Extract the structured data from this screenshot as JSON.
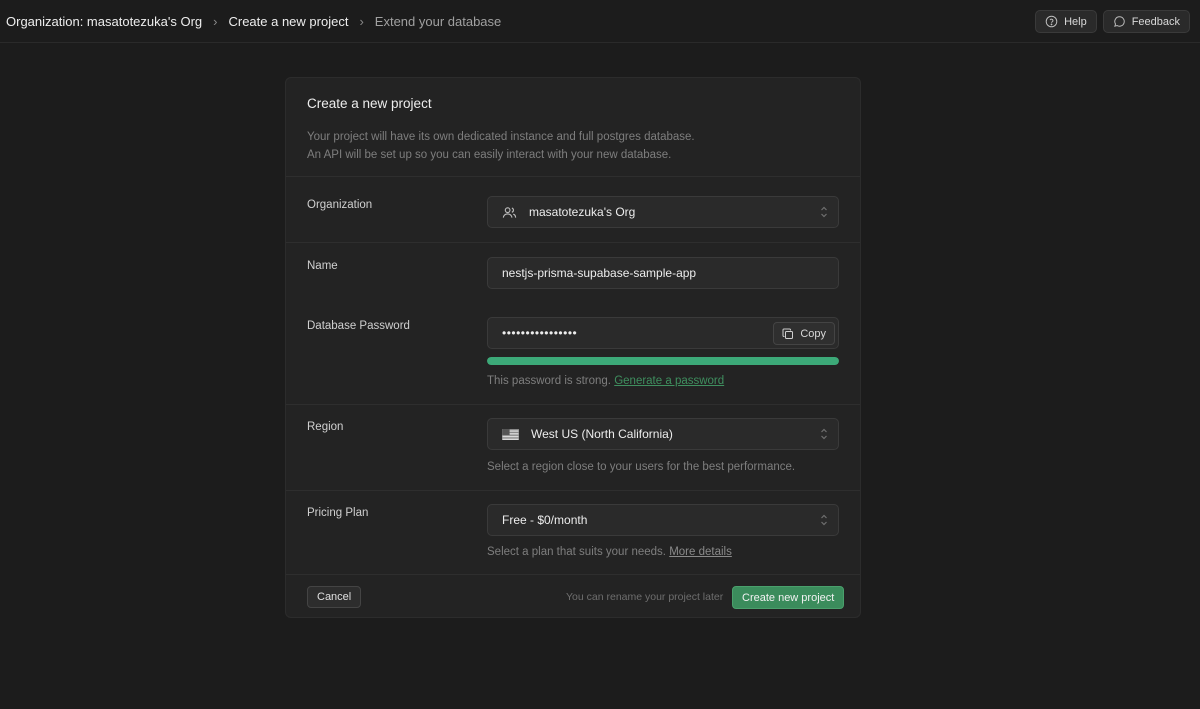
{
  "breadcrumb": {
    "items": [
      "Organization: masatotezuka's Org",
      "Create a new project",
      "Extend your database"
    ]
  },
  "topbar": {
    "help_label": "Help",
    "feedback_label": "Feedback"
  },
  "form": {
    "title": "Create a new project",
    "description_line1": "Your project will have its own dedicated instance and full postgres database.",
    "description_line2": "An API will be set up so you can easily interact with your new database.",
    "organization": {
      "label": "Organization",
      "value": "masatotezuka's Org"
    },
    "name": {
      "label": "Name",
      "value": "nestjs-prisma-supabase-sample-app"
    },
    "password": {
      "label": "Database Password",
      "value": "••••••••••••••••",
      "copy_label": "Copy",
      "strength_fraction": 1.0,
      "strength_color": "#3ecf8e",
      "hint": "This password is strong.",
      "generate_link": "Generate a password"
    },
    "region": {
      "label": "Region",
      "value": "West US (North California)",
      "flag": "us-flag-icon",
      "hint": "Select a region close to your users for the best performance."
    },
    "plan": {
      "label": "Pricing Plan",
      "value": "Free - $0/month",
      "hint": "Select a plan that suits your needs.",
      "details_link": "More details"
    },
    "cancel_label": "Cancel",
    "footer_note": "You can rename your project later",
    "create_label": "Create new project"
  },
  "colors": {
    "accent": "#3ecf8e",
    "background": "#1c1c1c",
    "card": "#232323"
  }
}
